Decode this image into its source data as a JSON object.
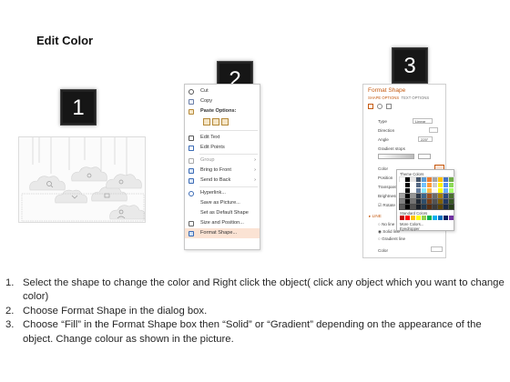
{
  "title": "Edit Color",
  "badges": [
    "1",
    "2",
    "3"
  ],
  "context_menu": {
    "items": [
      {
        "label": "Cut",
        "icon": "scissors-icon",
        "submenu": false
      },
      {
        "label": "Copy",
        "icon": "copy-icon",
        "submenu": false
      },
      {
        "label": "Paste Options:",
        "icon": "paste-icon",
        "submenu": false
      },
      {
        "label": "Edit Text",
        "icon": "edit-text-icon",
        "submenu": false
      },
      {
        "label": "Edit Points",
        "icon": "edit-points-icon",
        "submenu": false
      },
      {
        "label": "Group",
        "icon": "group-icon",
        "submenu": true
      },
      {
        "label": "Bring to Front",
        "icon": "bring-front-icon",
        "submenu": true
      },
      {
        "label": "Send to Back",
        "icon": "send-back-icon",
        "submenu": true
      },
      {
        "label": "Hyperlink...",
        "icon": "hyperlink-icon",
        "submenu": false
      },
      {
        "label": "Save as Picture...",
        "icon": "",
        "submenu": false
      },
      {
        "label": "Set as Default Shape",
        "icon": "",
        "submenu": false
      },
      {
        "label": "Size and Position...",
        "icon": "size-position-icon",
        "submenu": false
      },
      {
        "label": "Format Shape...",
        "icon": "format-shape-icon",
        "submenu": false,
        "selected": true
      }
    ]
  },
  "format_shape": {
    "title": "Format Shape",
    "tab_shape": "SHAPE OPTIONS",
    "tab_text": "TEXT OPTIONS",
    "fields": [
      {
        "label": "Type",
        "value": "Linear"
      },
      {
        "label": "Direction",
        "value": ""
      },
      {
        "label": "Angle",
        "value": "225°"
      },
      {
        "label": "Gradient stops",
        "value": ""
      },
      {
        "label": "Color",
        "value": ""
      },
      {
        "label": "Position",
        "value": ""
      },
      {
        "label": "Transparency",
        "value": ""
      },
      {
        "label": "Brightness",
        "value": ""
      }
    ],
    "rotate_label": "Rotate with shape",
    "line_section": "LINE",
    "line_options": [
      "No line",
      "Solid line",
      "Gradient line"
    ],
    "bottom_color_label": "Color",
    "theme_colors_label": "Theme Colors",
    "standard_colors_label": "Standard Colors",
    "more_colors_label": "More Colors...",
    "eyedropper_label": "Eyedropper",
    "accent_color": "#c55a11"
  },
  "instructions": [
    {
      "num": "1.",
      "text": "Select the shape to change the color and Right click the object( click any object which you want to change color)"
    },
    {
      "num": "2.",
      "text": "Choose Format Shape in the dialog box."
    },
    {
      "num": "3.",
      "text": "Choose “Fill” in the Format Shape box then “Solid” or “Gradient” depending on the appearance of the object. Change colour as shown in the picture."
    }
  ]
}
